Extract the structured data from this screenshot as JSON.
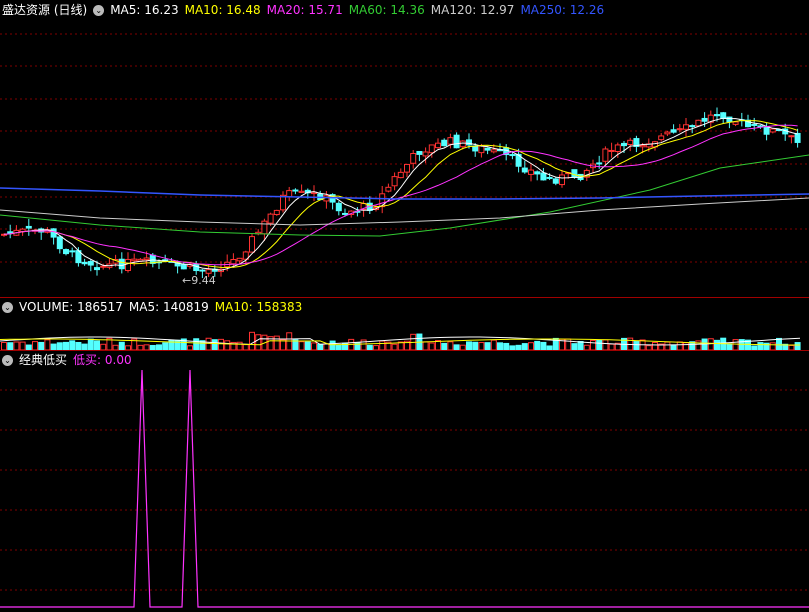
{
  "main": {
    "title": "盛达资源 (日线)",
    "ma": [
      {
        "label": "MA5: 16.23",
        "color": "#ffffff"
      },
      {
        "label": "MA10: 16.48",
        "color": "#ffff00"
      },
      {
        "label": "MA20: 15.71",
        "color": "#ff33ff"
      },
      {
        "label": "MA60: 14.36",
        "color": "#33cc33"
      },
      {
        "label": "MA120: 12.97",
        "color": "#cccccc"
      },
      {
        "label": "MA250: 12.26",
        "color": "#3355ff"
      }
    ],
    "low_annotation": "9.44"
  },
  "volume": {
    "label": "VOLUME: 186517",
    "ma5": "MA5: 140819",
    "ma10": "MA10: 158383"
  },
  "indicator": {
    "title": "经典低买",
    "series_label": "低买: 0.00"
  },
  "colors": {
    "up": "#ff3232",
    "down": "#54ffff",
    "grid": "#800000",
    "background": "#000000"
  }
}
